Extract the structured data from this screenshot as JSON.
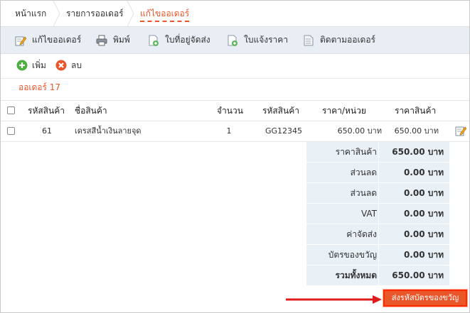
{
  "breadcrumb": {
    "items": [
      "หน้าแรก",
      "รายการออเดอร์",
      "แก้ไขออเดอร์"
    ]
  },
  "toolbar": {
    "edit_order": "แก้ไขออเดอร์",
    "print": "พิมพ์",
    "delivery_note": "ใบที่อยู่จัดส่ง",
    "quotation": "ใบแจ้งราคา",
    "track_order": "ติดตามออเดอร์"
  },
  "actions": {
    "add": "เพิ่ม",
    "delete": "ลบ"
  },
  "order_title": "ออเดอร์ 17",
  "table": {
    "headers": [
      "รหัสสินค้า",
      "ชื่อสินค้า",
      "จำนวน",
      "รหัสสินค้า",
      "ราคา/หน่วย",
      "ราคาสินค้า"
    ],
    "rows": [
      {
        "id": "61",
        "name": "เดรสสีน้ำเงินลายจุด",
        "qty": "1",
        "sku": "GG12345",
        "unit_price": "650.00 บาท",
        "price": "650.00 บาท"
      }
    ]
  },
  "summary": [
    {
      "label": "ราคาสินค้า",
      "value": "650.00 บาท"
    },
    {
      "label": "ส่วนลด",
      "value": "0.00 บาท"
    },
    {
      "label": "ส่วนลด",
      "value": "0.00 บาท"
    },
    {
      "label": "VAT",
      "value": "0.00 บาท"
    },
    {
      "label": "ค่าจัดส่ง",
      "value": "0.00 บาท"
    },
    {
      "label": "บัตรของขวัญ",
      "value": "0.00 บาท"
    },
    {
      "label": "รวมทั้งหมด",
      "value": "650.00 บาท"
    }
  ],
  "send_button": "ส่งรหัสบัตรของขวัญ",
  "colors": {
    "accent": "#e8562a",
    "toolbar_bg": "#e9eef4",
    "summary_bg": "#e9f0f6",
    "arrow": "#e01b1b"
  }
}
